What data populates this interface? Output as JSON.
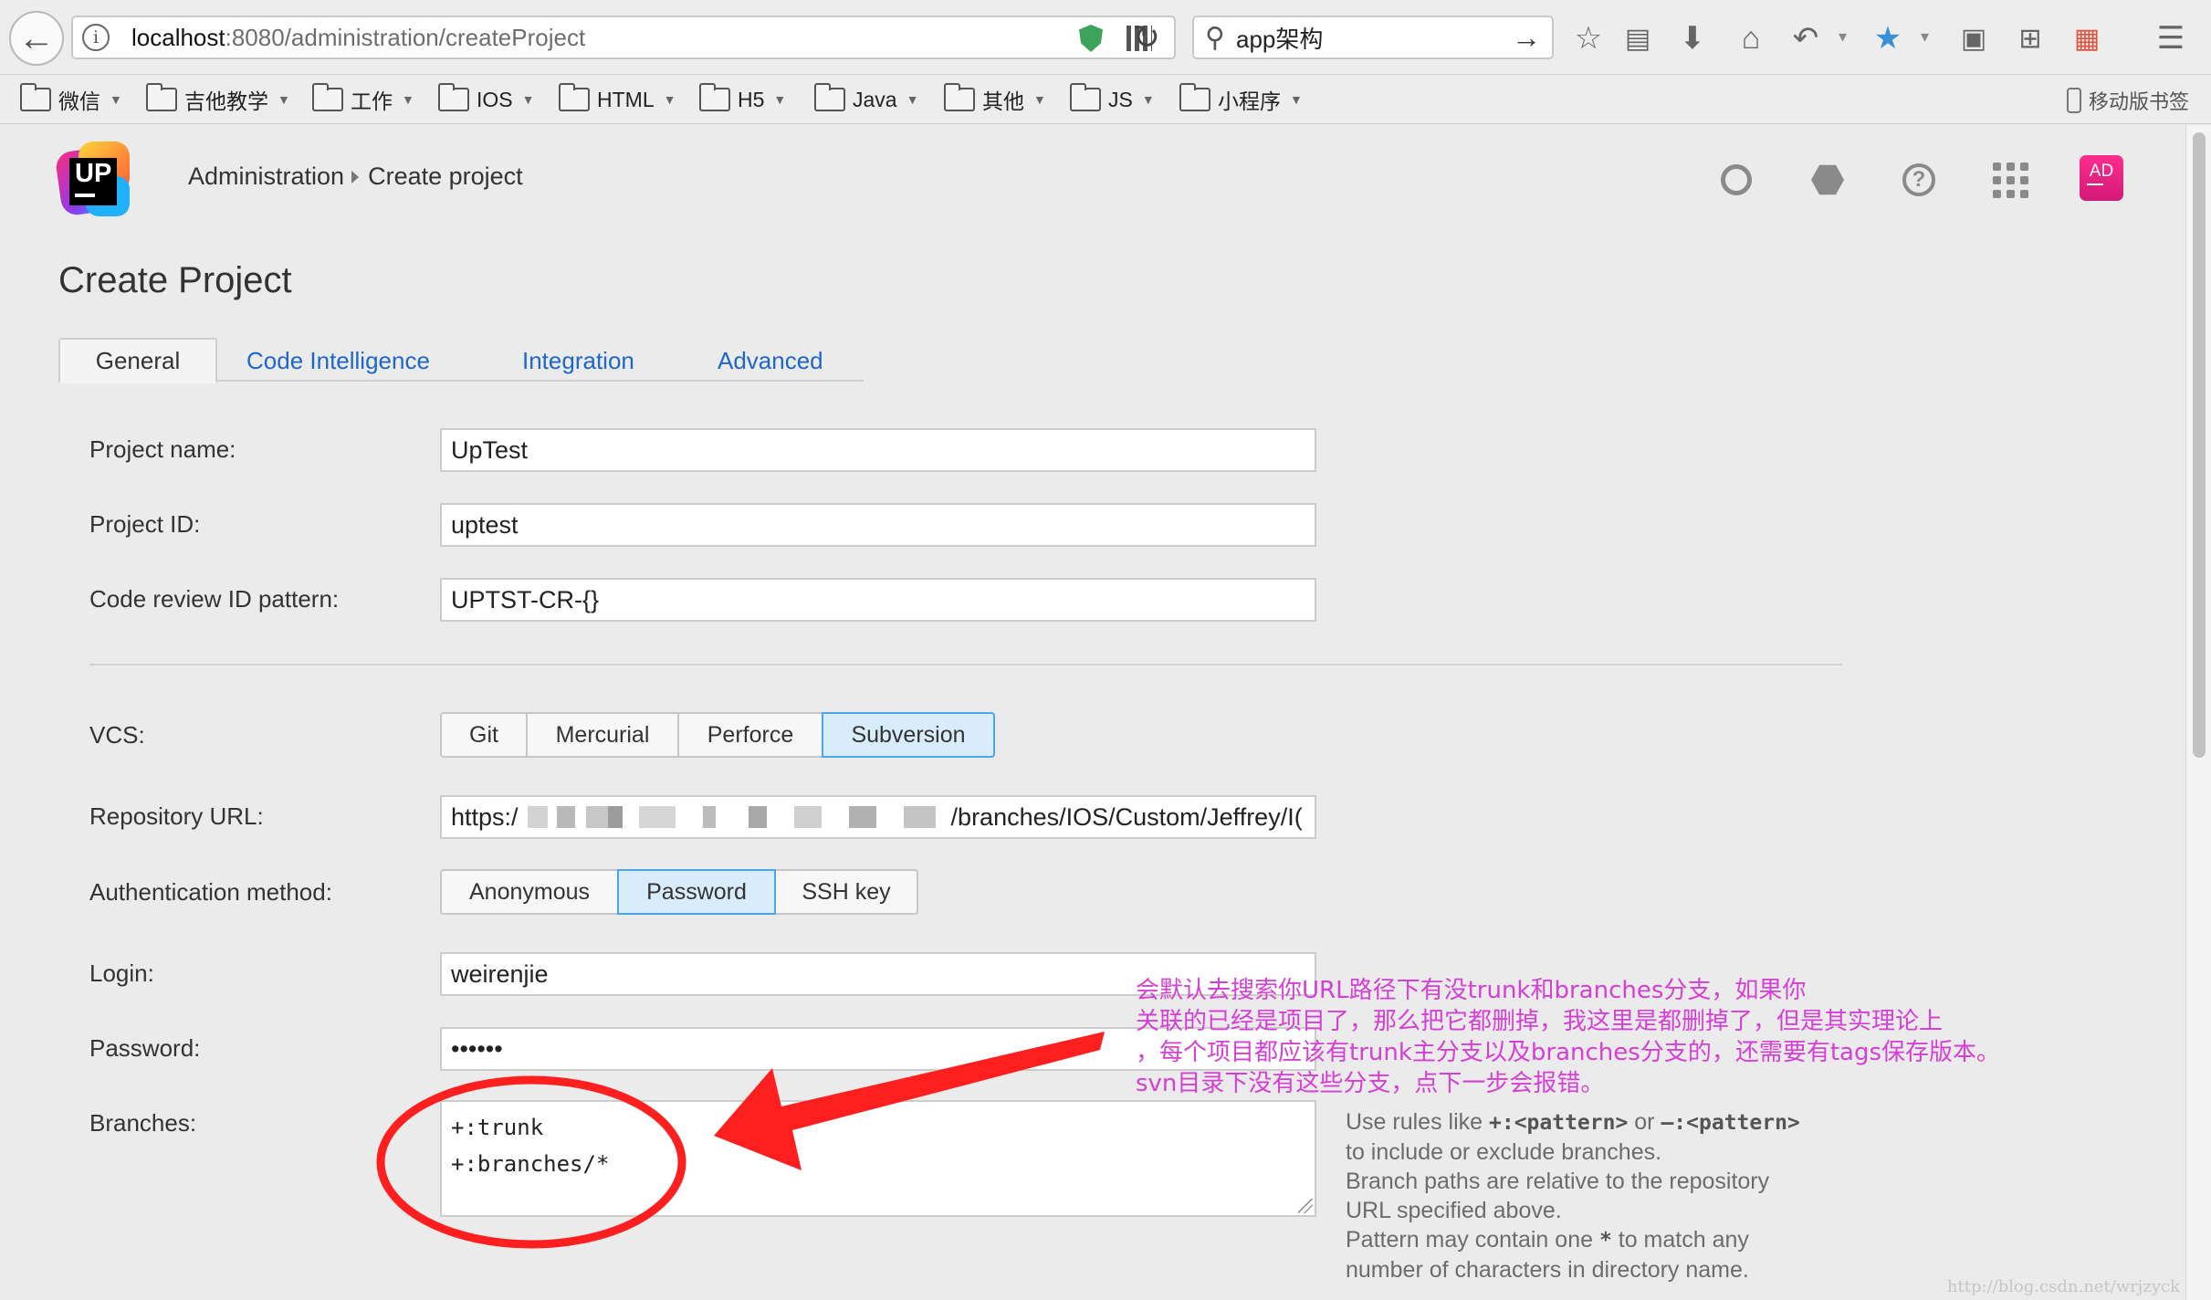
{
  "browser": {
    "url_host": "localhost",
    "url_path": ":8080/administration/createProject",
    "search_query": "app架构",
    "bookmarks": [
      {
        "label": "微信"
      },
      {
        "label": "吉他教学"
      },
      {
        "label": "工作"
      },
      {
        "label": "IOS"
      },
      {
        "label": "HTML"
      },
      {
        "label": "H5"
      },
      {
        "label": "Java"
      },
      {
        "label": "其他"
      },
      {
        "label": "JS"
      },
      {
        "label": "小程序"
      }
    ],
    "mobile_bookmarks": "移动版书签"
  },
  "header": {
    "logo_text": "UP",
    "breadcrumb": [
      "Administration",
      "Create project"
    ],
    "avatar_initials": "AD"
  },
  "page": {
    "title": "Create Project",
    "tabs": [
      "General",
      "Code Intelligence",
      "Integration",
      "Advanced"
    ],
    "active_tab": "General"
  },
  "form": {
    "project_name": {
      "label": "Project name:",
      "value": "UpTest"
    },
    "project_id": {
      "label": "Project ID:",
      "value": "uptest"
    },
    "review_pattern": {
      "label": "Code review ID pattern:",
      "value": "UPTST-CR-{}"
    },
    "vcs": {
      "label": "VCS:",
      "options": [
        "Git",
        "Mercurial",
        "Perforce",
        "Subversion"
      ],
      "selected": "Subversion"
    },
    "repo_url": {
      "label": "Repository URL:",
      "prefix": "https:/",
      "suffix": "/branches/IOS/Custom/Jeffrey/I("
    },
    "auth": {
      "label": "Authentication method:",
      "options": [
        "Anonymous",
        "Password",
        "SSH key"
      ],
      "selected": "Password"
    },
    "login": {
      "label": "Login:",
      "value": "weirenjie"
    },
    "password": {
      "label": "Password:",
      "value": "••••••"
    },
    "branches": {
      "label": "Branches:",
      "lines": [
        "+:trunk",
        "+:branches/*"
      ]
    }
  },
  "help": {
    "line1_pre": "Use rules like ",
    "line1_code1": "+:<pattern>",
    "line1_mid": " or ",
    "line1_code2": "–:<pattern>",
    "line2": "to include or exclude branches.",
    "line3": "Branch paths are relative to the repository",
    "line4": "URL specified above.",
    "line5_pre": "Pattern may contain one ",
    "line5_star": "*",
    "line5_post": " to match any",
    "line6": "number of characters in directory name."
  },
  "annotation": {
    "lines": [
      "会默认去搜索你URL路径下有没trunk和branches分支，如果你",
      "关联的已经是项目了，那么把它都删掉，我这里是都删掉了，但是其实理论上",
      "，每个项目都应该有trunk主分支以及branches分支的，还需要有tags保存版本。",
      "svn目录下没有这些分支，点下一步会报错。"
    ],
    "color": "#d53fd6"
  },
  "watermark": "http://blog.csdn.net/wrjzyck"
}
